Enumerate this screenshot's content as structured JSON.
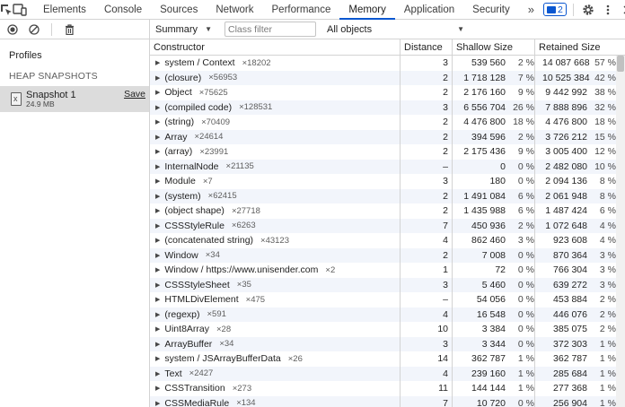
{
  "tabs": [
    {
      "label": "Elements"
    },
    {
      "label": "Console"
    },
    {
      "label": "Sources"
    },
    {
      "label": "Network"
    },
    {
      "label": "Performance"
    },
    {
      "label": "Memory"
    },
    {
      "label": "Application"
    },
    {
      "label": "Security"
    }
  ],
  "active_tab": "Memory",
  "more_tabs_glyph": "»",
  "issues_badge": "2",
  "sidebar": {
    "profiles_label": "Profiles",
    "heading": "HEAP SNAPSHOTS",
    "snapshot": {
      "name": "Snapshot 1",
      "size": "24.9 MB",
      "save_label": "Save"
    }
  },
  "toolbar": {
    "view": "Summary",
    "filter_placeholder": "Class filter",
    "objects": "All objects"
  },
  "columns": {
    "constructor": "Constructor",
    "distance": "Distance",
    "shallow": "Shallow Size",
    "retained": "Retained Size"
  },
  "rows": [
    {
      "name": "system / Context",
      "count": "×18202",
      "distance": "3",
      "shallow": "539 560",
      "shallow_pct": "2 %",
      "retained": "14 087 668",
      "retained_pct": "57 %"
    },
    {
      "name": "(closure)",
      "count": "×56953",
      "distance": "2",
      "shallow": "1 718 128",
      "shallow_pct": "7 %",
      "retained": "10 525 384",
      "retained_pct": "42 %"
    },
    {
      "name": "Object",
      "count": "×75625",
      "distance": "2",
      "shallow": "2 176 160",
      "shallow_pct": "9 %",
      "retained": "9 442 992",
      "retained_pct": "38 %"
    },
    {
      "name": "(compiled code)",
      "count": "×128531",
      "distance": "3",
      "shallow": "6 556 704",
      "shallow_pct": "26 %",
      "retained": "7 888 896",
      "retained_pct": "32 %"
    },
    {
      "name": "(string)",
      "count": "×70409",
      "distance": "2",
      "shallow": "4 476 800",
      "shallow_pct": "18 %",
      "retained": "4 476 800",
      "retained_pct": "18 %"
    },
    {
      "name": "Array",
      "count": "×24614",
      "distance": "2",
      "shallow": "394 596",
      "shallow_pct": "2 %",
      "retained": "3 726 212",
      "retained_pct": "15 %"
    },
    {
      "name": "(array)",
      "count": "×23991",
      "distance": "2",
      "shallow": "2 175 436",
      "shallow_pct": "9 %",
      "retained": "3 005 400",
      "retained_pct": "12 %"
    },
    {
      "name": "InternalNode",
      "count": "×21135",
      "distance": "–",
      "shallow": "0",
      "shallow_pct": "0 %",
      "retained": "2 482 080",
      "retained_pct": "10 %"
    },
    {
      "name": "Module",
      "count": "×7",
      "distance": "3",
      "shallow": "180",
      "shallow_pct": "0 %",
      "retained": "2 094 136",
      "retained_pct": "8 %"
    },
    {
      "name": "(system)",
      "count": "×62415",
      "distance": "2",
      "shallow": "1 491 084",
      "shallow_pct": "6 %",
      "retained": "2 061 948",
      "retained_pct": "8 %"
    },
    {
      "name": "(object shape)",
      "count": "×27718",
      "distance": "2",
      "shallow": "1 435 988",
      "shallow_pct": "6 %",
      "retained": "1 487 424",
      "retained_pct": "6 %"
    },
    {
      "name": "CSSStyleRule",
      "count": "×6263",
      "distance": "7",
      "shallow": "450 936",
      "shallow_pct": "2 %",
      "retained": "1 072 648",
      "retained_pct": "4 %"
    },
    {
      "name": "(concatenated string)",
      "count": "×43123",
      "distance": "4",
      "shallow": "862 460",
      "shallow_pct": "3 %",
      "retained": "923 608",
      "retained_pct": "4 %"
    },
    {
      "name": "Window",
      "count": "×34",
      "distance": "2",
      "shallow": "7 008",
      "shallow_pct": "0 %",
      "retained": "870 364",
      "retained_pct": "3 %"
    },
    {
      "name": "Window / https://www.unisender.com",
      "count": "×2",
      "distance": "1",
      "shallow": "72",
      "shallow_pct": "0 %",
      "retained": "766 304",
      "retained_pct": "3 %"
    },
    {
      "name": "CSSStyleSheet",
      "count": "×35",
      "distance": "3",
      "shallow": "5 460",
      "shallow_pct": "0 %",
      "retained": "639 272",
      "retained_pct": "3 %"
    },
    {
      "name": "HTMLDivElement",
      "count": "×475",
      "distance": "–",
      "shallow": "54 056",
      "shallow_pct": "0 %",
      "retained": "453 884",
      "retained_pct": "2 %"
    },
    {
      "name": "(regexp)",
      "count": "×591",
      "distance": "4",
      "shallow": "16 548",
      "shallow_pct": "0 %",
      "retained": "446 076",
      "retained_pct": "2 %"
    },
    {
      "name": "Uint8Array",
      "count": "×28",
      "distance": "10",
      "shallow": "3 384",
      "shallow_pct": "0 %",
      "retained": "385 075",
      "retained_pct": "2 %"
    },
    {
      "name": "ArrayBuffer",
      "count": "×34",
      "distance": "3",
      "shallow": "3 344",
      "shallow_pct": "0 %",
      "retained": "372 303",
      "retained_pct": "1 %"
    },
    {
      "name": "system / JSArrayBufferData",
      "count": "×26",
      "distance": "14",
      "shallow": "362 787",
      "shallow_pct": "1 %",
      "retained": "362 787",
      "retained_pct": "1 %"
    },
    {
      "name": "Text",
      "count": "×2427",
      "distance": "4",
      "shallow": "239 160",
      "shallow_pct": "1 %",
      "retained": "285 684",
      "retained_pct": "1 %"
    },
    {
      "name": "CSSTransition",
      "count": "×273",
      "distance": "11",
      "shallow": "144 144",
      "shallow_pct": "1 %",
      "retained": "277 368",
      "retained_pct": "1 %"
    },
    {
      "name": "CSSMediaRule",
      "count": "×134",
      "distance": "7",
      "shallow": "10 720",
      "shallow_pct": "0 %",
      "retained": "256 904",
      "retained_pct": "1 %"
    }
  ]
}
